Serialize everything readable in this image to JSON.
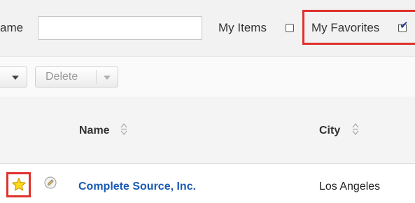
{
  "filter": {
    "name_label": "ame",
    "name_value": "",
    "my_items_label": "My Items",
    "my_items_checked": false,
    "my_favorites_label": "My Favorites",
    "my_favorites_checked": true,
    "highlight_color": "#e0312b"
  },
  "toolbar": {
    "delete_label": "Delete"
  },
  "table": {
    "columns": [
      {
        "label": "Name",
        "sortable": true
      },
      {
        "label": "City",
        "sortable": true
      }
    ],
    "rows": [
      {
        "favorite": true,
        "name": "Complete Source, Inc.",
        "city": "Los Angeles",
        "link_color": "#1a5ab3"
      }
    ]
  },
  "icons": {
    "favorite": "star-icon",
    "edit": "pencil-icon",
    "sort": "sort-arrows-icon",
    "dropdown": "chevron-down-icon",
    "checkbox_checked": "checkmark-icon"
  }
}
